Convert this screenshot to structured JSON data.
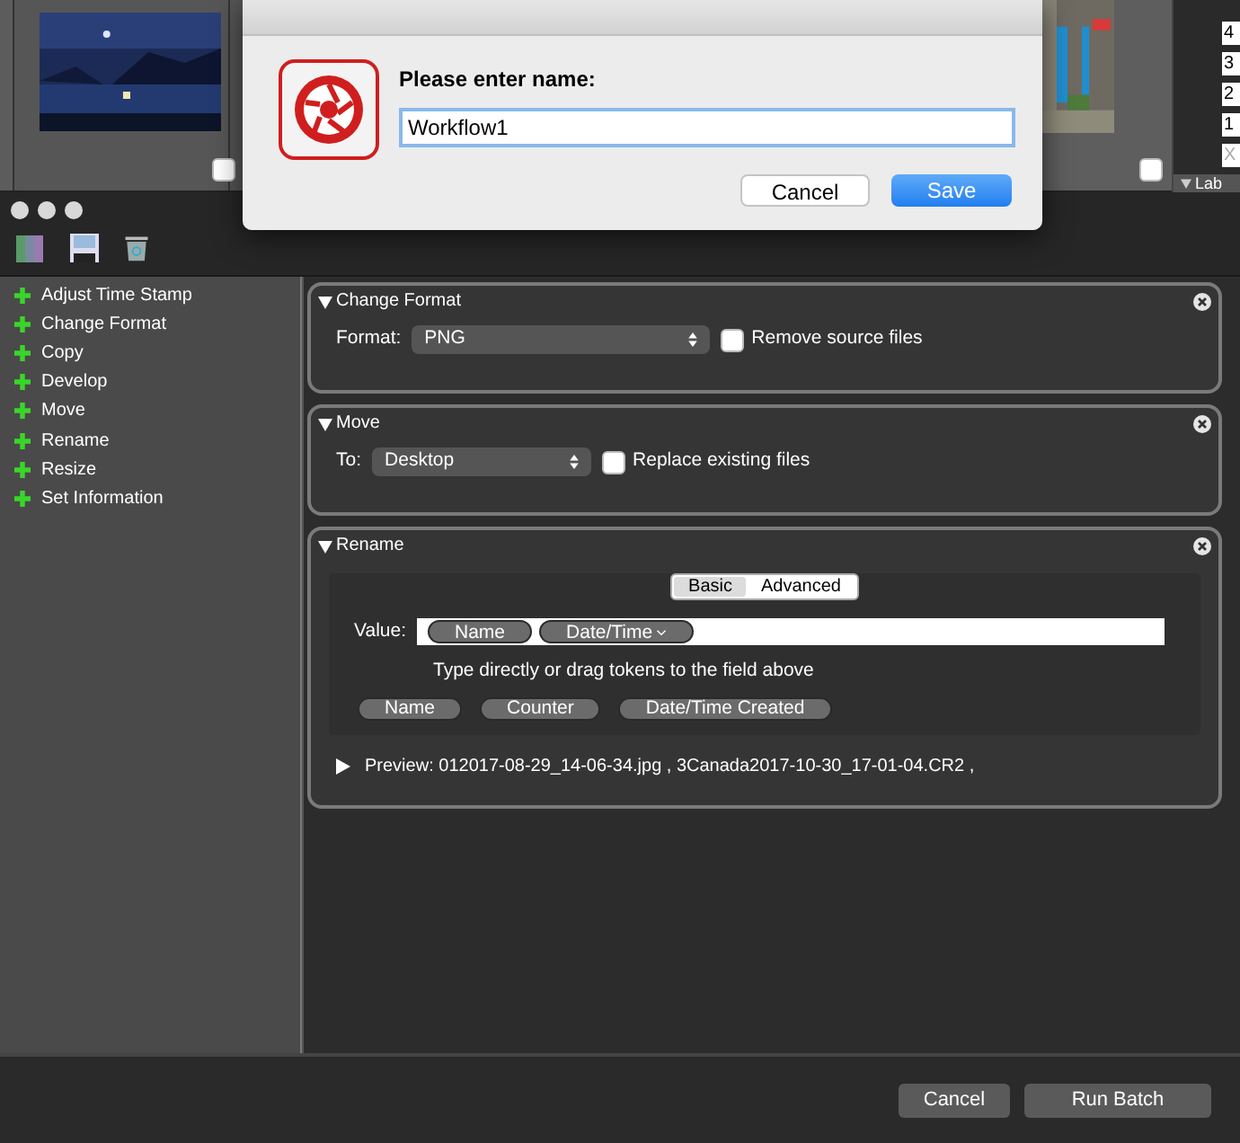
{
  "browser": {
    "rating_filters": [
      "4",
      "3",
      "2",
      "1",
      "X"
    ],
    "side_label": "Lab"
  },
  "dialog": {
    "prompt": "Please enter name:",
    "value": "Workflow1",
    "buttons": [
      {
        "label": "Cancel",
        "default": false
      },
      {
        "label": "Save",
        "default": true
      }
    ]
  },
  "sidebar": {
    "items": [
      "Adjust Time Stamp",
      "Change Format",
      "Copy",
      "Develop",
      "Move",
      "Rename",
      "Resize",
      "Set Information"
    ]
  },
  "actions": [
    {
      "kind": "select",
      "title": "Change Format",
      "field_label": "Format:",
      "value": "PNG",
      "checkbox": {
        "label": "Remove source files",
        "checked": false
      }
    },
    {
      "kind": "select",
      "title": "Move",
      "field_label": "To:",
      "value": "Desktop",
      "checkbox": {
        "label": "Replace existing files",
        "checked": false
      }
    },
    {
      "kind": "rename",
      "title": "Rename",
      "tabs": [
        {
          "label": "Basic",
          "selected": true
        },
        {
          "label": "Advanced",
          "selected": false
        }
      ],
      "value_label": "Value:",
      "tokens": [
        {
          "label": "Name",
          "dropdown": false
        },
        {
          "label": "Date/Time",
          "dropdown": true
        }
      ],
      "hint": "Type directly or drag tokens to the field above",
      "available_tokens": [
        "Name",
        "Counter",
        "Date/Time Created"
      ],
      "preview_label": "Preview:",
      "preview": "012017-08-29_14-06-34.jpg , 3Canada2017-10-30_17-01-04.CR2 ,"
    }
  ],
  "footer": {
    "buttons": [
      "Cancel",
      "Run Batch"
    ]
  }
}
